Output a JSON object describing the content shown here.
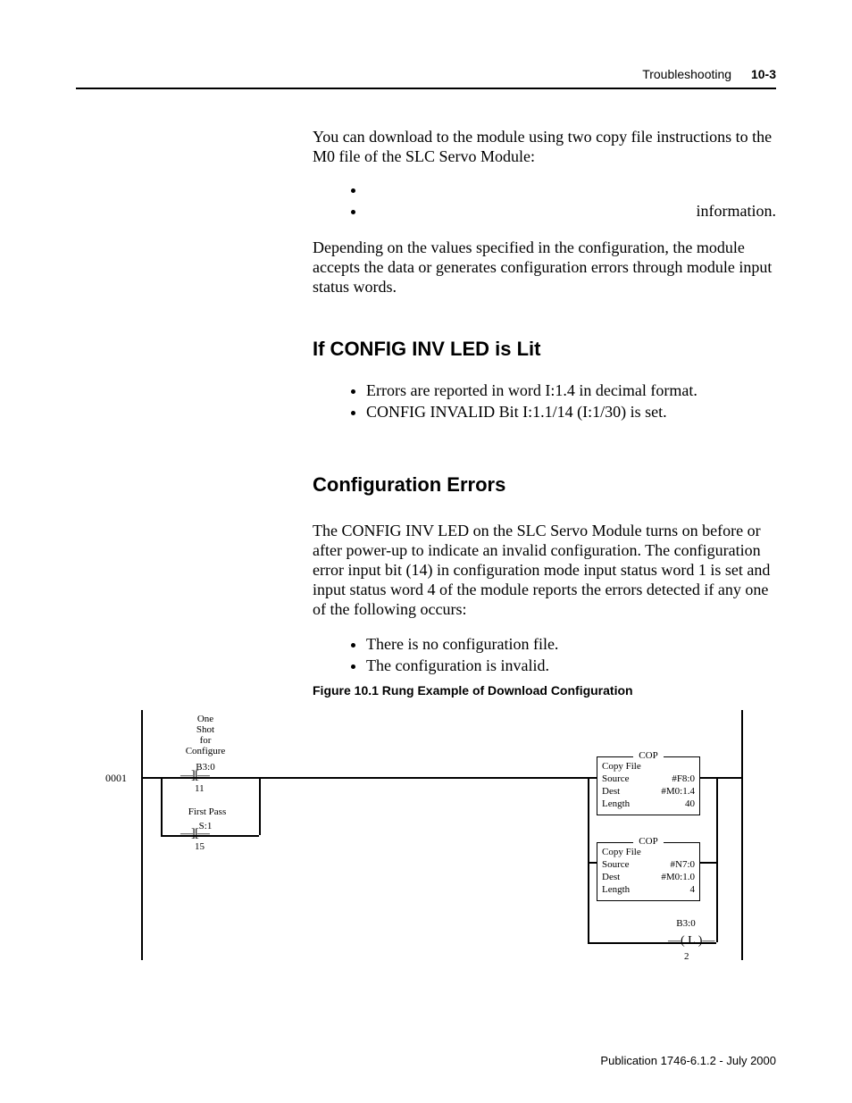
{
  "header": {
    "section": "Troubleshooting",
    "page": "10-3"
  },
  "intro1": "You can download to the module using two copy file instructions to the M0 file of the SLC Servo Module:",
  "bullets1": [
    "",
    "information."
  ],
  "intro2": "Depending on the values specified in the configuration, the module accepts the data or generates configuration errors through module input status words.",
  "h2a": "If CONFIG INV LED is Lit",
  "bullets2": [
    "Errors are reported in word I:1.4 in decimal format.",
    "CONFIG INVALID Bit I:1.1/14 (I:1/30) is set."
  ],
  "h2b": "Configuration Errors",
  "intro3": "The CONFIG INV LED on the SLC Servo Module turns on before or after power-up to indicate an invalid configuration. The configuration error input bit (14) in configuration mode input status word 1 is set and input status word 4 of the module reports the errors detected if any one of the following occurs:",
  "bullets3": [
    "There is no configuration file.",
    "The configuration is invalid."
  ],
  "figcaption": "Figure 10.1   Rung Example of Download Configuration",
  "diagram": {
    "rung_number": "0001",
    "branch1_comment": "One\nShot\nfor\nConfigure",
    "branch1_tag": "B3:0",
    "branch1_bit": "11",
    "branch2_comment": "First Pass",
    "branch2_tag": "S:1",
    "branch2_bit": "15",
    "xic_glyph": "—] [—",
    "cop_title": "COP",
    "cop1": {
      "type": "Copy File",
      "source_lbl": "Source",
      "source_val": "#F8:0",
      "dest_lbl": "Dest",
      "dest_val": "#M0:1.4",
      "length_lbl": "Length",
      "length_val": "40"
    },
    "cop2": {
      "type": "Copy File",
      "source_lbl": "Source",
      "source_val": "#N7:0",
      "dest_lbl": "Dest",
      "dest_val": "#M0:1.0",
      "length_lbl": "Length",
      "length_val": "4"
    },
    "latch_tag": "B3:0",
    "latch_glyph": "—( L )—",
    "latch_bit": "2"
  },
  "footer": "Publication 1746-6.1.2 - July 2000"
}
